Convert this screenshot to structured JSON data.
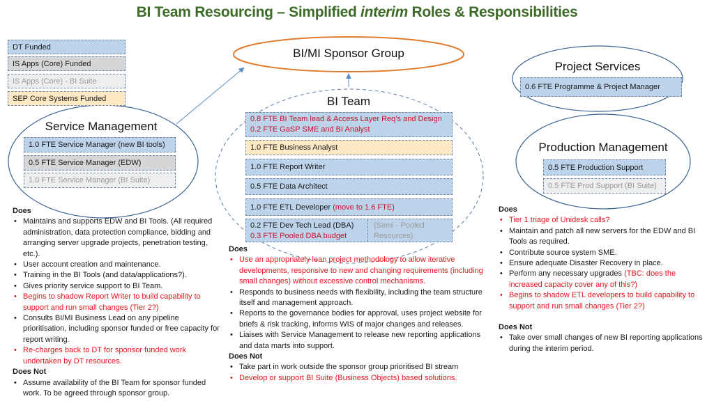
{
  "title": {
    "part1": "BI Team Resourcing – Simplified ",
    "part2_italic": "interim",
    "part3": " Roles & Responsibilities"
  },
  "legend": [
    {
      "label": "DT Funded",
      "color": "#bcd3ea"
    },
    {
      "label": "IS Apps (Core) Funded",
      "color": "#d6d6d6"
    },
    {
      "label": "IS Apps (Core) - BI Suite",
      "color": "#eeeeee"
    },
    {
      "label": "SEP Core Systems Funded",
      "color": "#fde9c4"
    }
  ],
  "sponsor_group": {
    "label": "BI/MI Sponsor Group",
    "color": "#e07b2e"
  },
  "service_management": {
    "label": "Service Management",
    "roles": [
      "1.0 FTE Service Manager (new BI tools)",
      "0.5 FTE Service Manager (EDW)",
      "1.0 FTE Service Manager (BI Suite)"
    ],
    "does_heading": "Does",
    "does": [
      {
        "text": "Maintains and supports EDW and BI Tools. (All required administration, data protection compliance, bidding and arranging server upgrade projects, penetration testing, etc.).",
        "highlight": false
      },
      {
        "text": "User account creation and maintenance.",
        "highlight": false
      },
      {
        "text": "Training in the BI Tools (and data/applications?).",
        "highlight": false
      },
      {
        "text": "Gives priority service support to BI Team.",
        "highlight": false
      },
      {
        "text": "Begins to shadow Report Writer to build capability to support and run small changes (Tier 2?)",
        "highlight": true
      },
      {
        "text": "Consults BI/MI Business Lead on any pipeline prioritisation, including sponsor funded or free capacity for report writing.",
        "highlight": false
      },
      {
        "text": "Re-charges back to DT for sponsor funded work undertaken by DT resources.",
        "highlight": true
      }
    ],
    "does_not_heading": "Does Not",
    "does_not": [
      {
        "text": "Assume availability of the BI Team for sponsor funded work. To be agreed through sponsor group.",
        "highlight": false
      }
    ]
  },
  "bi_team": {
    "label": "BI Team",
    "lead_line1": "0.8 FTE BI Team lead & Access Layer Req’s and Design",
    "lead_line2": "0.2 FTE GaSP SME and BI Analyst",
    "business_analyst": "1.0 FTE Business Analyst",
    "report_writer": "1.0 FTE Report Writer",
    "data_architect": "0.5 FTE Data Architect",
    "etl_developer": "1.0 FTE ETL Developer ",
    "etl_developer_note": "(move to 1.6 FTE)",
    "dev_tech_lead": "0.2 FTE Dev Tech Lead (DBA)",
    "pooled_dba": "0.3 FTE Pooled DBA budget",
    "semi_pooled_line1": "(Semi - Pooled",
    "semi_pooled_line2": "Resources)",
    "does_heading": "Does",
    "does": [
      {
        "text": "Use an appropriately lean project methodology to allow iterative developments, responsive to new and changing requirements (including small changes) without excessive control mechanisms.",
        "highlight": true
      },
      {
        "text": "Responds to business needs with flexibility, including the team structure itself and management approach.",
        "highlight": false
      },
      {
        "text": "Reports to the governance bodies for approval, uses project website for briefs & risk tracking, informs WIS of major changes and releases.",
        "highlight": false
      },
      {
        "text": "Liaises with Service Management to release new reporting applications and data marts into support.",
        "highlight": false
      }
    ],
    "does_not_heading": "Does Not",
    "does_not": [
      {
        "text": "Take part in work outside the sponsor group prioritised BI stream",
        "highlight": false
      },
      {
        "text": "Develop or support BI Suite (Business Objects) based solutions.",
        "highlight": true
      }
    ]
  },
  "project_services": {
    "label": "Project Services",
    "roles": [
      "0.6 FTE Programme & Project Manager"
    ]
  },
  "production_management": {
    "label": "Production Management",
    "roles": [
      "0.5 FTE Production Support",
      "0.5 FTE Prod Support (BI Suite)"
    ],
    "does_heading": "Does",
    "does": [
      {
        "text": "Tier 1 triage of Unidesk calls?",
        "highlight": true
      },
      {
        "text": "Maintain and patch all new servers for the EDW and BI Tools as required.",
        "highlight": false
      },
      {
        "text": "Contribute source system SME.",
        "highlight": false
      },
      {
        "text": "Ensure adequate Disaster Recovery in place.",
        "highlight": false
      },
      {
        "text": "Perform any necessary upgrades ",
        "highlight": false,
        "suffix": "(TBC: does the increased capacity cover any of this?)"
      },
      {
        "text": "Begins to shadow ETL developers to build capability to support and run small changes (Tier 2?)",
        "highlight": true
      }
    ],
    "does_not_heading": "Does Not",
    "does_not": [
      {
        "text": "Take over small changes of new BI reporting applications during the interim period.",
        "highlight": false
      }
    ]
  }
}
